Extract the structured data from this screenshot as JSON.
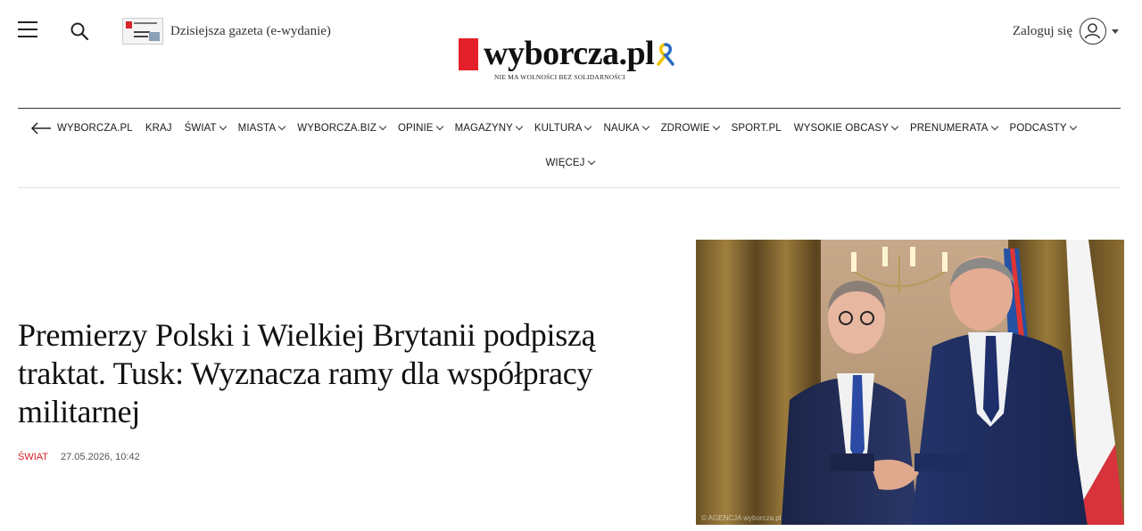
{
  "header": {
    "todays_paper_label": "Dzisiejsza gazeta (e-wydanie)",
    "logo_text": "wyborcza.pl",
    "tagline": "NIE MA WOLNOŚCI BEZ SOLIDARNOŚCI",
    "login_label": "Zaloguj się"
  },
  "nav": {
    "home_label": "WYBORCZA.PL",
    "items": [
      {
        "label": "KRAJ",
        "has_dropdown": false
      },
      {
        "label": "ŚWIAT",
        "has_dropdown": true
      },
      {
        "label": "MIASTA",
        "has_dropdown": true
      },
      {
        "label": "WYBORCZA.BIZ",
        "has_dropdown": true
      },
      {
        "label": "OPINIE",
        "has_dropdown": true
      },
      {
        "label": "MAGAZYNY",
        "has_dropdown": true
      },
      {
        "label": "KULTURA",
        "has_dropdown": true
      },
      {
        "label": "NAUKA",
        "has_dropdown": true
      },
      {
        "label": "ZDROWIE",
        "has_dropdown": true
      },
      {
        "label": "SPORT.PL",
        "has_dropdown": false
      },
      {
        "label": "WYSOKIE OBCASY",
        "has_dropdown": true
      },
      {
        "label": "PRENUMERATA",
        "has_dropdown": true
      },
      {
        "label": "PODCASTY",
        "has_dropdown": true
      }
    ],
    "more_label": "WIĘCEJ"
  },
  "article": {
    "headline": "Premierzy Polski i Wielkiej Brytanii podpiszą traktat. Tusk: Wyznacza ramy dla współpracy militarnej",
    "section": "ŚWIAT",
    "date": "27.05.2026, 10:42",
    "photo_credit": "© AGENCJA wyborcza.pl"
  },
  "colors": {
    "brand_red": "#e4202a",
    "section_red": "#d31f27",
    "text": "#111111"
  },
  "icons": [
    "hamburger-menu-icon",
    "search-icon",
    "newspaper-thumbnail",
    "ukraine-ribbon-icon",
    "user-icon",
    "caret-down-icon",
    "arrow-left-icon",
    "chevron-down-icon"
  ]
}
